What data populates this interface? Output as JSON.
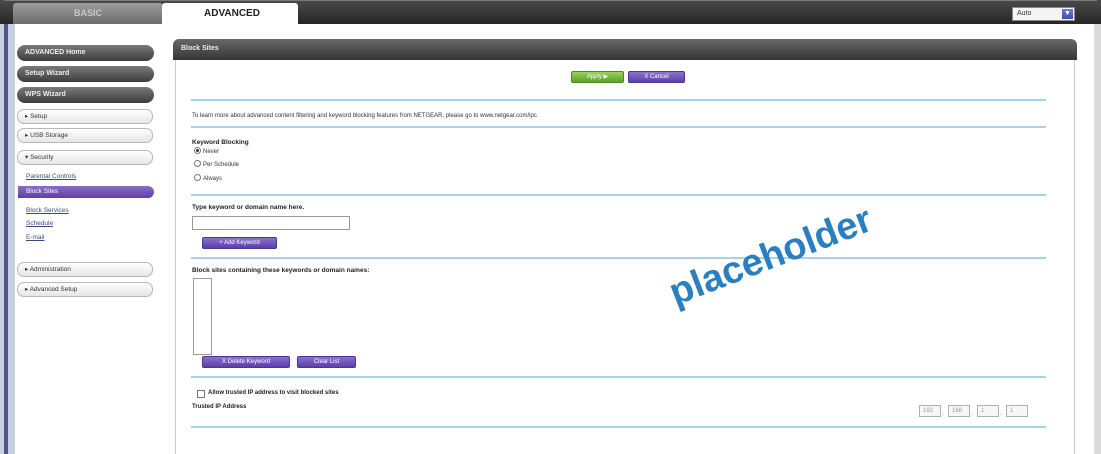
{
  "tabs": {
    "basic": "BASIC",
    "advanced": "ADVANCED"
  },
  "language": {
    "selected": "Auto"
  },
  "sidebar": {
    "advanced_home": "ADVANCED Home",
    "setup_wizard": "Setup Wizard",
    "wps_wizard": "WPS Wizard",
    "setup": "▸ Setup",
    "usb_storage": "▸ USB Storage",
    "security": "▾ Security",
    "security_items": [
      "Parental Controls",
      "Block Sites",
      "Block Services",
      "Schedule",
      "E-mail"
    ],
    "administration": "▸ Administration",
    "advanced_setup": "▸ Advanced Setup"
  },
  "panel": {
    "title": "Block Sites",
    "apply_label": "Apply ▶",
    "cancel_label": "X Cancel",
    "info_text": "To learn more about advanced content filtering and keyword blocking features from NETGEAR, please go to www.netgear.com/lpc",
    "keyword_blocking": {
      "label": "Keyword Blocking",
      "options": [
        "Never",
        "Per Schedule",
        "Always"
      ],
      "selected": "Never"
    },
    "keyword_input": {
      "label": "Type keyword or domain name here.",
      "value": ""
    },
    "add_keyword_label": "+ Add Keyword",
    "block_list": {
      "label": "Block sites containing these keywords or domain names:"
    },
    "delete_keyword_label": "X Delete Keyword",
    "clear_list_label": "Clear List",
    "allow_trusted": {
      "label": "Allow trusted IP address to visit blocked sites",
      "checked": false
    },
    "trusted_ip": {
      "label": "Trusted IP Address",
      "octets": [
        "192",
        "168",
        "1",
        "1"
      ]
    }
  },
  "watermark": "placeholder"
}
